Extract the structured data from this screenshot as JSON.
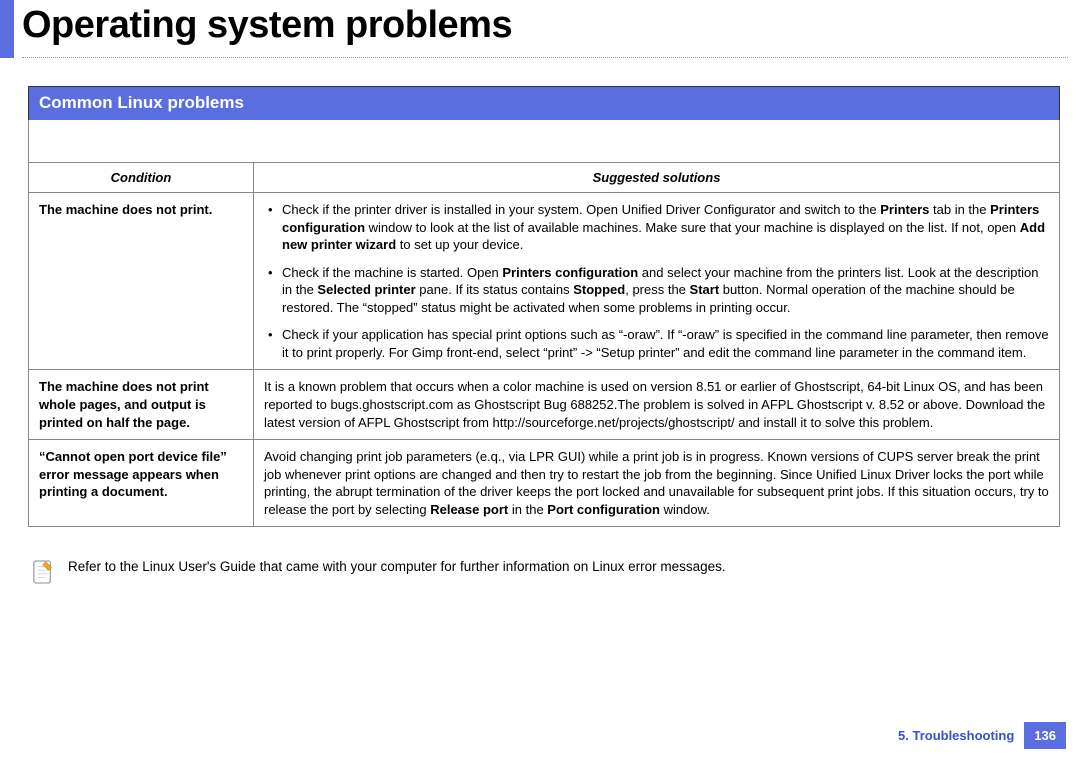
{
  "pageTitle": "Operating system problems",
  "sectionHeader": "Common Linux problems",
  "table": {
    "headers": {
      "condition": "Condition",
      "solutions": "Suggested solutions"
    },
    "rows": [
      {
        "condition": "The machine does not print.",
        "bullets": [
          {
            "pre": "Check if the printer driver is installed in your system. Open Unified Driver Configurator and switch to the ",
            "b1": "Printers",
            "mid1": " tab in the ",
            "b2": "Printers configuration",
            "mid2": " window to look at the list of available machines. Make sure that your machine is displayed on the list. If not, open ",
            "b3": "Add new printer wizard",
            "post": " to set up your device."
          },
          {
            "pre": "Check if the machine is started. Open ",
            "b1": "Printers configuration",
            "mid1": " and select your machine from the printers list. Look at the description in the ",
            "b2": "Selected printer",
            "mid2": " pane. If its status contains ",
            "b3": "Stopped",
            "mid3": ", press the ",
            "b4": "Start",
            "post": " button. Normal operation of the machine should be restored. The “stopped” status might be activated when some problems in printing occur."
          },
          {
            "pre": "Check if your application has special print options such as “-oraw”. If “-oraw” is specified in the command line parameter, then remove it to print properly. For Gimp front-end, select “print” -> “Setup printer” and edit the command line parameter in the command item.",
            "b1": "",
            "mid1": "",
            "b2": "",
            "mid2": "",
            "b3": "",
            "post": ""
          }
        ]
      },
      {
        "condition": "The machine does not print whole pages, and output is printed on half the page.",
        "text": "It is a known problem that occurs when a color machine is used on version 8.51 or earlier of Ghostscript, 64-bit Linux OS, and has been reported to bugs.ghostscript.com as Ghostscript Bug 688252.The problem is solved in AFPL Ghostscript v. 8.52 or above. Download the latest version of AFPL Ghostscript from http://sourceforge.net/projects/ghostscript/ and install it to solve this problem."
      },
      {
        "condition": "“Cannot open port device file” error message appears when printing a document.",
        "richtext": {
          "pre": "Avoid changing print job parameters (e.q., via LPR GUI) while a print job is in progress. Known versions of CUPS server break the print job whenever print options are changed and then try to restart the job from the beginning. Since Unified Linux Driver locks the port while printing, the abrupt termination of the driver keeps the port locked and unavailable for subsequent print jobs. If this situation occurs, try to release the port by selecting ",
          "b1": "Release port",
          "mid1": " in the ",
          "b2": "Port configuration",
          "post": " window."
        }
      }
    ]
  },
  "note": "Refer to the Linux User's Guide that came with your computer for further information on Linux error messages.",
  "footer": {
    "chapter": "5.  Troubleshooting",
    "page": "136"
  }
}
